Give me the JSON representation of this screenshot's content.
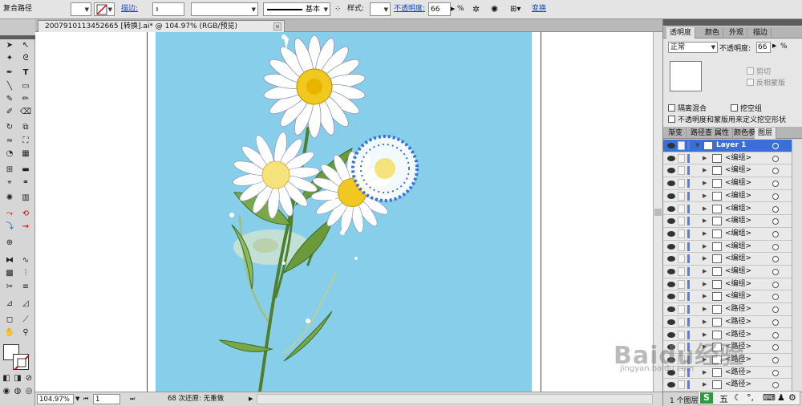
{
  "control_bar": {
    "object_type": "复合路径",
    "stroke_link": "描边:",
    "brush_label": "基本",
    "style_label": "样式:",
    "opacity_link": "不透明度:",
    "opacity_value": "66",
    "opacity_unit": "%",
    "transform_link": "变换"
  },
  "document": {
    "tab_title": "2007910113452665 [转换].ai* @ 104.97% (RGB/预览)",
    "close_glyph": "✕"
  },
  "status_bar": {
    "zoom": "104.97%",
    "page": "1",
    "undo_text": "68 次还原: 无重做"
  },
  "transparency_panel": {
    "tabs": [
      "透明度",
      "颜色",
      "外观",
      "描边"
    ],
    "blend_mode": "正常",
    "opacity_label": "不透明度:",
    "opacity_value": "66",
    "clip_label": "剪切",
    "invert_mask_label": "反相蒙版",
    "isolate_blending_label": "隔离混合",
    "knockout_group_label": "挖空组",
    "opacity_mask_label": "不透明度和蒙版用来定义挖空形状"
  },
  "layers_panel": {
    "tabs": [
      "渐变",
      "路径查",
      "属性",
      "颜色参",
      "图层"
    ],
    "layers": [
      {
        "name": "Layer 1"
      },
      {
        "name": "<编组>"
      },
      {
        "name": "<编组>"
      },
      {
        "name": "<编组>"
      },
      {
        "name": "<编组>"
      },
      {
        "name": "<编组>"
      },
      {
        "name": "<编组>"
      },
      {
        "name": "<编组>"
      },
      {
        "name": "<编组>"
      },
      {
        "name": "<编组>"
      },
      {
        "name": "<编组>"
      },
      {
        "name": "<编组>"
      },
      {
        "name": "<编组>"
      },
      {
        "name": "<路径>"
      },
      {
        "name": "<路径>"
      },
      {
        "name": "<路径>"
      },
      {
        "name": "<路径>"
      },
      {
        "name": "<路径>"
      },
      {
        "name": "<路径>"
      },
      {
        "name": "<路径>"
      }
    ],
    "footer_count": "1 个图层"
  },
  "watermark": {
    "brand": "Baidu经验",
    "url": "jingyan.baidu.com"
  },
  "ime_bar": {
    "mode": "五"
  },
  "icons": [
    "selection-tool-icon",
    "direct-selection-icon",
    "pen-icon",
    "type-icon",
    "line-icon",
    "rectangle-icon",
    "brush-icon",
    "pencil-icon",
    "rotate-icon",
    "scale-icon",
    "warp-icon",
    "free-transform-icon",
    "symbol-sprayer-icon",
    "graph-icon",
    "mesh-icon",
    "gradient-icon",
    "eyedropper-icon",
    "blend-icon",
    "live-paint-icon",
    "slice-icon",
    "eraser-icon",
    "hand-icon",
    "zoom-icon",
    "fill-swatch-icon",
    "stroke-swatch-icon",
    "eye-icon",
    "close-icon",
    "chevron-down-icon"
  ],
  "colors": {
    "artboard": "#87ceeb",
    "selection": "#3a6fd8",
    "stem": "#6a9a3a",
    "petal": "#ffffff",
    "center": "#f0c820"
  }
}
